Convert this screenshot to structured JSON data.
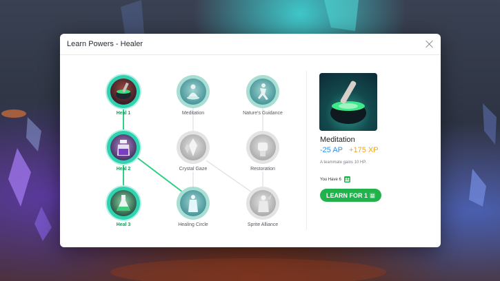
{
  "modal": {
    "title": "Learn Powers - Healer"
  },
  "tree": {
    "nodes": [
      {
        "id": "heal1",
        "label": "Heal 1",
        "state": "learned",
        "icon": "cauldron-icon"
      },
      {
        "id": "meditation",
        "label": "Meditation",
        "state": "available",
        "icon": "meditating-figure-icon"
      },
      {
        "id": "natures_guidance",
        "label": "Nature's Guidance",
        "state": "available",
        "icon": "running-figure-icon"
      },
      {
        "id": "heal2",
        "label": "Heal 2",
        "state": "learned",
        "icon": "potion-bottle-icon"
      },
      {
        "id": "crystal_gaze",
        "label": "Crystal Gaze",
        "state": "locked",
        "icon": "crystal-icon"
      },
      {
        "id": "restoration",
        "label": "Restoration",
        "state": "locked",
        "icon": "fist-icon"
      },
      {
        "id": "heal3",
        "label": "Heal 3",
        "state": "learned",
        "icon": "flask-icon"
      },
      {
        "id": "healing_circle",
        "label": "Healing Circle",
        "state": "available",
        "icon": "glowing-figure-icon"
      },
      {
        "id": "sprite_alliance",
        "label": "Sprite Alliance",
        "state": "locked",
        "icon": "sprite-figure-icon"
      }
    ]
  },
  "detail": {
    "name": "Meditation",
    "ap_cost": "-25 AP",
    "xp_gain": "+175 XP",
    "description": "A teammate gains 10 HP.",
    "have_label": "You Have 6",
    "learn_label": "LEARN FOR 1"
  },
  "colors": {
    "learned_ring": "#2fd2b1",
    "available_ring": "#a8ded3",
    "locked_ring": "#e3e3e6",
    "learn_button": "#22b24c",
    "ap_color": "#2a8ff0",
    "xp_color": "#f2a41a",
    "learned_label": "#1c9b5b"
  }
}
